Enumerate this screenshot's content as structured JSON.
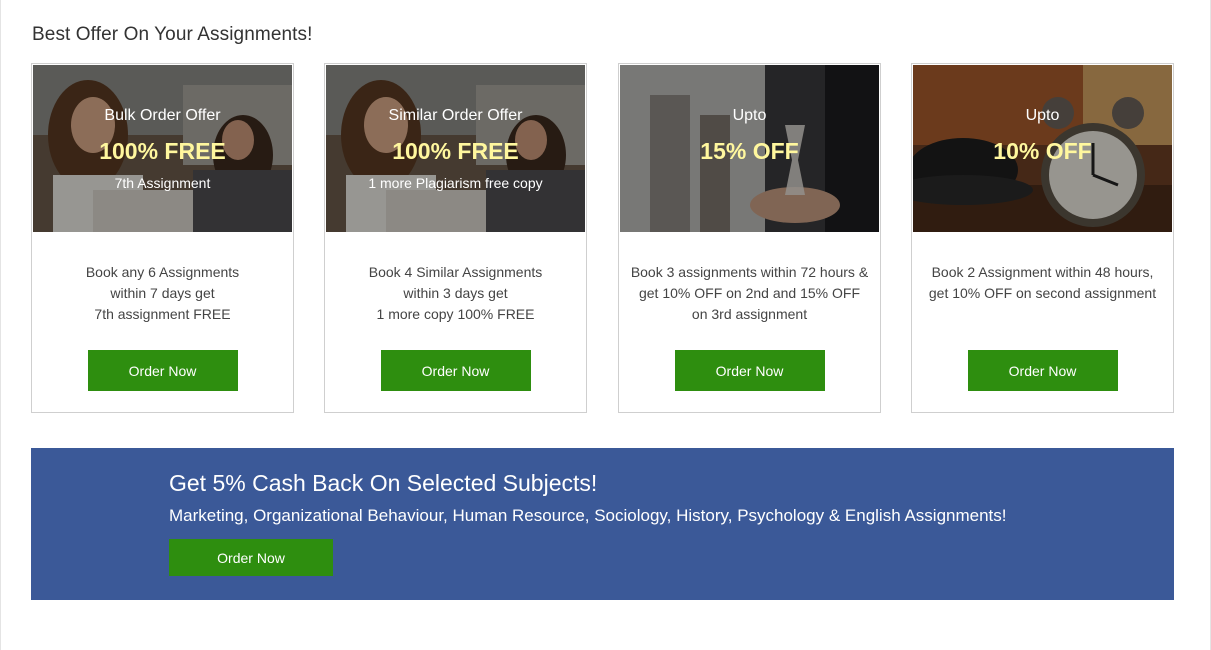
{
  "section": {
    "title": "Best Offer On Your Assignments!"
  },
  "cards": [
    {
      "line1": "Bulk Order Offer",
      "line2": "100% FREE",
      "line3": "7th Assignment",
      "desc": [
        "Book any 6 Assignments",
        "within 7 days get",
        "7th assignment FREE"
      ],
      "button": "Order Now"
    },
    {
      "line1": "Similar Order Offer",
      "line2": "100% FREE",
      "line3": "1 more Plagiarism free copy",
      "desc": [
        "Book 4 Similar Assignments",
        "within 3 days get",
        "1 more copy 100% FREE"
      ],
      "button": "Order Now"
    },
    {
      "line1": "Upto",
      "line2": "15% OFF",
      "line3": "",
      "desc": [
        "Book 3 assignments within 72 hours &",
        "get 10% OFF on 2nd and 15% OFF",
        "on 3rd assignment"
      ],
      "button": "Order Now"
    },
    {
      "line1": "Upto",
      "line2": "10% OFF",
      "line3": "",
      "desc": [
        "Book 2 Assignment within 48 hours,",
        "get 10% OFF on second assignment"
      ],
      "button": "Order Now"
    }
  ],
  "banner": {
    "title": "Get 5% Cash Back On Selected Subjects!",
    "subtitle": "Marketing, Organizational Behaviour, Human Resource, Sociology, History, Psychology & English Assignments!",
    "button": "Order Now"
  },
  "colors": {
    "button_green": "#2e8e0f",
    "banner_blue": "#3b5998",
    "highlight_yellow": "#fff79e"
  },
  "images": [
    "students-studying-photo",
    "students-studying-photo",
    "hourglass-hand-photo",
    "alarm-clock-coffee-photo"
  ]
}
